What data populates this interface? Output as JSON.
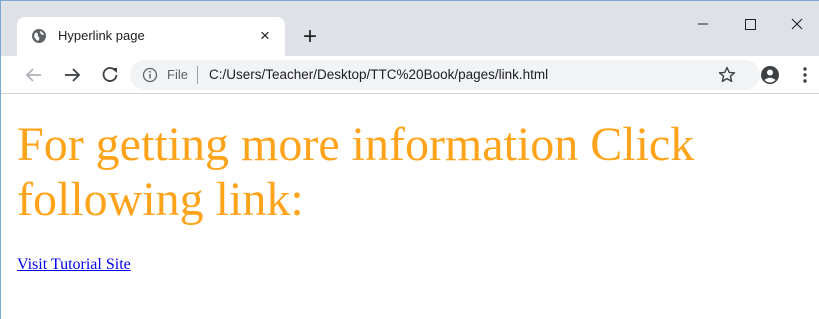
{
  "tab": {
    "title": "Hyperlink page",
    "close_glyph": "×",
    "favicon": "globe-icon"
  },
  "new_tab_glyph": "+",
  "window_controls": {
    "minimize": "minimize-icon",
    "maximize": "maximize-icon",
    "close": "close-icon"
  },
  "toolbar": {
    "back": "back-arrow-icon",
    "forward": "forward-arrow-icon",
    "reload": "reload-icon"
  },
  "omnibox": {
    "info_icon": "info-icon",
    "scheme_label": "File",
    "url": "C:/Users/Teacher/Desktop/TTC%20Book/pages/link.html",
    "bookmark_icon": "star-icon"
  },
  "profile_icon": "profile-icon",
  "menu_icon": "kebab-menu-icon",
  "page": {
    "heading": "For getting more information Click following link:",
    "link_text": "Visit Tutorial Site"
  },
  "colors": {
    "heading": "#ffa31a",
    "link": "#0000ee",
    "tabstrip": "#dee1e6",
    "omnibox": "#f1f3f4"
  }
}
